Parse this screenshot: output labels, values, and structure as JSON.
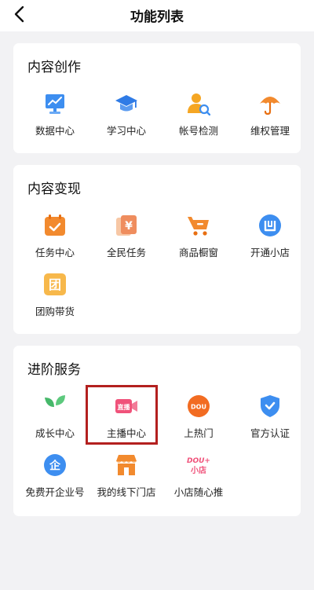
{
  "header": {
    "title": "功能列表"
  },
  "sections": [
    {
      "title": "内容创作",
      "items": [
        {
          "label": "数据中心",
          "icon": "chart-board-icon"
        },
        {
          "label": "学习中心",
          "icon": "graduation-cap-icon"
        },
        {
          "label": "帐号检测",
          "icon": "user-search-icon"
        },
        {
          "label": "维权管理",
          "icon": "umbrella-icon"
        }
      ]
    },
    {
      "title": "内容变现",
      "items": [
        {
          "label": "任务中心",
          "icon": "task-calendar-icon"
        },
        {
          "label": "全民任务",
          "icon": "yen-coin-icon"
        },
        {
          "label": "商品橱窗",
          "icon": "shopping-cart-icon"
        },
        {
          "label": "开通小店",
          "icon": "store-icon"
        },
        {
          "label": "团购带货",
          "icon": "group-buy-icon",
          "icon_text": "团"
        }
      ]
    },
    {
      "title": "进阶服务",
      "items": [
        {
          "label": "成长中心",
          "icon": "sprout-icon"
        },
        {
          "label": "主播中心",
          "icon": "live-camera-icon",
          "icon_text": "直播"
        },
        {
          "label": "上热门",
          "icon": "dou-badge-icon",
          "icon_text": "DOU"
        },
        {
          "label": "官方认证",
          "icon": "verified-shield-icon"
        },
        {
          "label": "免费开企业号",
          "icon": "enterprise-icon",
          "icon_text": "企"
        },
        {
          "label": "我的线下门店",
          "icon": "storefront-icon"
        },
        {
          "label": "小店随心推",
          "icon": "dou-plus-shop-icon",
          "icon_text": "DOU+",
          "icon_text_2": "小店"
        }
      ]
    }
  ],
  "highlighted_item": "主播中心",
  "colors": {
    "accent_orange": "#f28a2e",
    "highlight_red": "#b3201f",
    "blue": "#3d8ef0",
    "green": "#46b86a"
  }
}
